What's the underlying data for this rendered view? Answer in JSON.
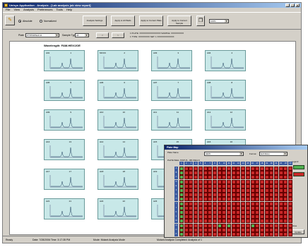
{
  "window": {
    "title": "Unisys Application - Analysis - [Lab analysis job view report]",
    "minimize": "_",
    "maximize": "□",
    "close": "×"
  },
  "menu": [
    "File",
    "View",
    "Analysis",
    "Preferences",
    "Tools",
    "Help"
  ],
  "toolbar": {
    "radio_1": "Absolute",
    "radio_2": "Normalized",
    "btn_1": "Analysis\nSettings",
    "btn_2": "Apply to\nAll Wells",
    "btn_3": "Apply to\nCurrent Plate",
    "btn_4": "Apply to\nCurrent Sample",
    "zoom_value": "100%"
  },
  "toolbar2": {
    "label_1": "Plate",
    "select_1": "PT8769/Well A1",
    "label_2": "Sample Type",
    "select_2": "All",
    "prev": "<",
    "next": ">",
    "info_1": "1 PLATE: XXXXXXXXXXXXXXX  SAMPLE: XXXXXXXXX",
    "info_2": "1 TYPE: XXXXXXXX  SET: 1  XXXXXXXXXXXX"
  },
  "content": {
    "title": "Wavelength: FAM-HEX/JOE"
  },
  "tiles": [
    {
      "id": "A01",
      "n": "1"
    },
    {
      "id": "MOCK",
      "n": "2"
    },
    {
      "id": "A03",
      "n": "3"
    },
    {
      "id": "A04",
      "n": "4"
    },
    {
      "id": "A05",
      "n": "5"
    },
    {
      "id": "A06",
      "n": "6"
    },
    {
      "id": "A07",
      "n": "7"
    },
    {
      "id": "A08",
      "n": "8"
    },
    {
      "id": "A09",
      "n": "9"
    },
    {
      "id": "A10",
      "n": "10"
    },
    {
      "id": "A11",
      "n": "11"
    },
    {
      "id": "A12",
      "n": "12"
    },
    {
      "id": "A13",
      "n": "13"
    },
    {
      "id": "A14",
      "n": "14"
    },
    {
      "id": "A15",
      "n": "15"
    },
    {
      "id": "A16",
      "n": "16"
    },
    {
      "id": "A17",
      "n": "17"
    },
    {
      "id": "A18",
      "n": "18"
    },
    {
      "id": "A19",
      "n": "19"
    },
    {
      "id": "A20",
      "n": "20"
    },
    {
      "id": "A21",
      "n": "21"
    },
    {
      "id": "A22",
      "n": "22"
    },
    {
      "id": "A23",
      "n": "23"
    },
    {
      "id": "A24",
      "n": "24"
    }
  ],
  "status": {
    "left": "Ready",
    "date": "Date: 7/28/2006 Time: 3:17:35 PM",
    "mode": "Mode: Mutant Analysis Mode",
    "analysis": "Mutant Analysis Completed: Analysis of 1"
  },
  "plate_dialog": {
    "title": "Plate Map",
    "label_plate": "Plate Name",
    "select_plate": "HEW",
    "label_format": "Format",
    "select_format": "Exhibition",
    "section": "PLATE WELL STATUS - 384 WELLS",
    "ok": "OK",
    "cancel": "Cancel",
    "legend_label": "Legend",
    "close_label": "Close",
    "update": "Update",
    "col_headers": [
      "1",
      "2",
      "3",
      "4",
      "5",
      "6",
      "7",
      "8",
      "9",
      "10",
      "11",
      "12",
      "13",
      "14",
      "15",
      "16",
      "17",
      "18",
      "19",
      "20",
      "21",
      "22",
      "23",
      "24"
    ],
    "row_headers": [
      "A",
      "B",
      "C",
      "D",
      "E",
      "F",
      "G",
      "H",
      "I",
      "J",
      "K",
      "L",
      "M",
      "N",
      "O",
      "P"
    ]
  },
  "colors": {
    "title_start": "#0a246a",
    "tile_bg": "#c8e8e8",
    "well_red": "#c82828",
    "well_green": "#50b050"
  }
}
